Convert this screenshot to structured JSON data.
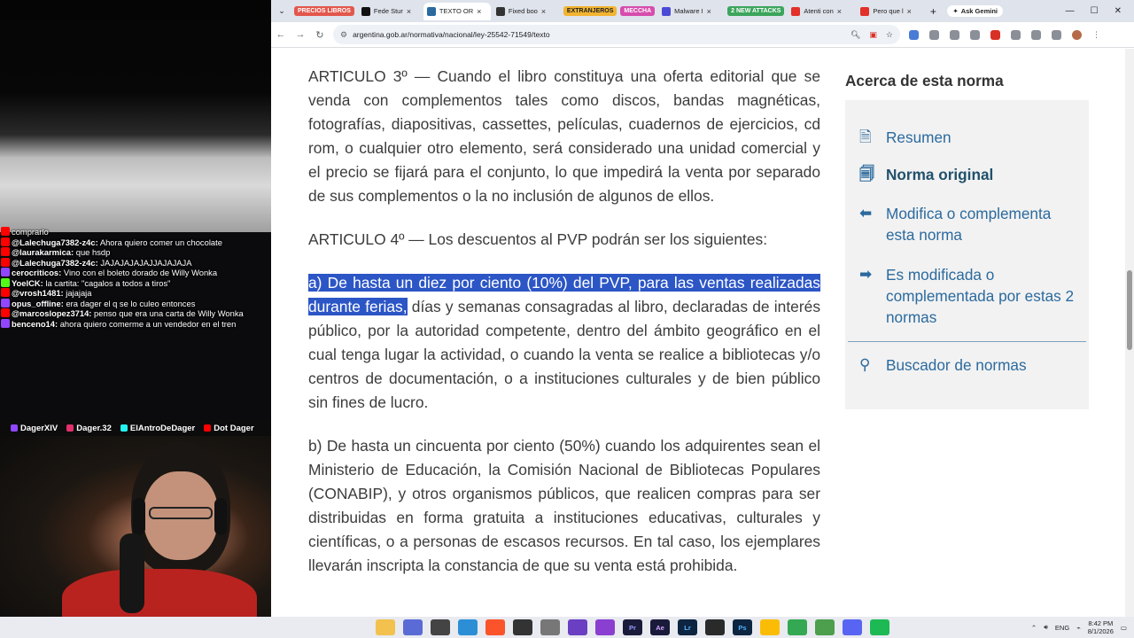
{
  "stream": {
    "chat": [
      {
        "badge": "b-yt",
        "user": "",
        "text": "comprarlo"
      },
      {
        "badge": "b-yt",
        "user": "@Lalechuga7382-z4c:",
        "text": "Ahora quiero comer un chocolate"
      },
      {
        "badge": "b-yt",
        "user": "@laurakarmica:",
        "text": "que hsdp"
      },
      {
        "badge": "b-yt",
        "user": "@Lalechuga7382-z4c:",
        "text": "JAJAJAJAJAJJAJAJAJA"
      },
      {
        "badge": "b-tw",
        "user": "cerocriticos:",
        "text": "Vino con el boleto dorado de Willy Wonka"
      },
      {
        "badge": "b-kick",
        "user": "YoelCK:",
        "text": "la cartita: \"cagalos a todos a tiros\""
      },
      {
        "badge": "b-yt",
        "user": "@vrosh1481:",
        "text": "jajajaja"
      },
      {
        "badge": "b-tw",
        "user": "opus_offline:",
        "text": "era dager el q se lo culeo entonces"
      },
      {
        "badge": "b-yt",
        "user": "@marcoslopez3714:",
        "text": "penso que era una carta de Willy Wonka"
      },
      {
        "badge": "b-tw",
        "user": "benceno14:",
        "text": "ahora quiero comerme a un vendedor en el tren"
      }
    ],
    "socials": [
      "DagerXIV",
      "Dager.32",
      "ElAntroDeDager",
      "Dot Dager"
    ]
  },
  "browser": {
    "tab_groups": [
      {
        "label": "PRECIOS LIBROS",
        "color": "#e2574c"
      },
      {
        "label": "EXTRANJEROS",
        "color": "#f2b431"
      },
      {
        "label": "MECCHA",
        "color": "#d64dad"
      },
      {
        "label": "2 NEW ATTACKS",
        "color": "#3ba55c"
      }
    ],
    "tabs": [
      {
        "label": "Fede Stur",
        "fav": "#111111"
      },
      {
        "label": "TEXTO OR",
        "fav": "#2b6a9e",
        "active": true
      },
      {
        "label": "Fixed boo",
        "fav": "#333333"
      },
      {
        "label": "Malware I",
        "fav": "#4a4ad6"
      },
      {
        "label": "Atenti con",
        "fav": "#e2302a"
      },
      {
        "label": "Pero que l",
        "fav": "#e2302a"
      }
    ],
    "gemini_label": "Ask Gemini",
    "url": "argentina.gob.ar/normativa/nacional/ley-25542-71549/texto"
  },
  "article": {
    "art3": "ARTICULO 3º — Cuando el libro constituya una oferta editorial que se venda con complementos tales como discos, bandas magnéticas, fotografías, diapositivas, cassettes, películas, cuadernos de ejercicios, cd rom, o cualquier otro elemento, será considerado una unidad comercial y el precio se fijará para el conjunto, lo que impedirá la venta por separado de sus complementos o la no inclusión de algunos de ellos.",
    "art4": "ARTICULO 4º — Los descuentos al PVP podrán ser los siguientes:",
    "a_highlight": "a) De hasta un diez por ciento (10%) del PVP, para las ventas realizadas durante ferias,",
    "a_rest": " días y semanas consagradas al libro, declaradas de interés público, por la autoridad competente, dentro del ámbito geográfico en el cual tenga lugar la actividad, o cuando la venta se realice a bibliotecas y/o centros de documentación, o a instituciones culturales y de bien público sin fines de lucro.",
    "b": "b) De hasta un cincuenta por ciento (50%) cuando los adquirentes sean el Ministerio de Educación, la Comisión Nacional de Bibliotecas Populares (CONABIP), y otros organismos públicos, que realicen compras para ser distribuidas en forma gratuita a instituciones educativas, culturales y científicas, o a personas de escasos recursos. En tal caso, los ejemplares llevarán inscripta la constancia de que su venta está prohibida."
  },
  "sidebar": {
    "title": "Acerca de esta norma",
    "items": [
      {
        "label": "Resumen",
        "icon": "document-icon"
      },
      {
        "label": "Norma original",
        "icon": "document-lines-icon"
      },
      {
        "label": "Modifica o complementa esta norma",
        "icon": "arrow-left-icon"
      },
      {
        "label": "Es modificada o complementada por estas 2 normas",
        "icon": "arrow-right-icon"
      },
      {
        "label": "Buscador de normas",
        "icon": "search-icon"
      }
    ]
  },
  "taskbar": {
    "lang": "ENG",
    "time": "8:42 PM",
    "date": "8/1/2026"
  }
}
